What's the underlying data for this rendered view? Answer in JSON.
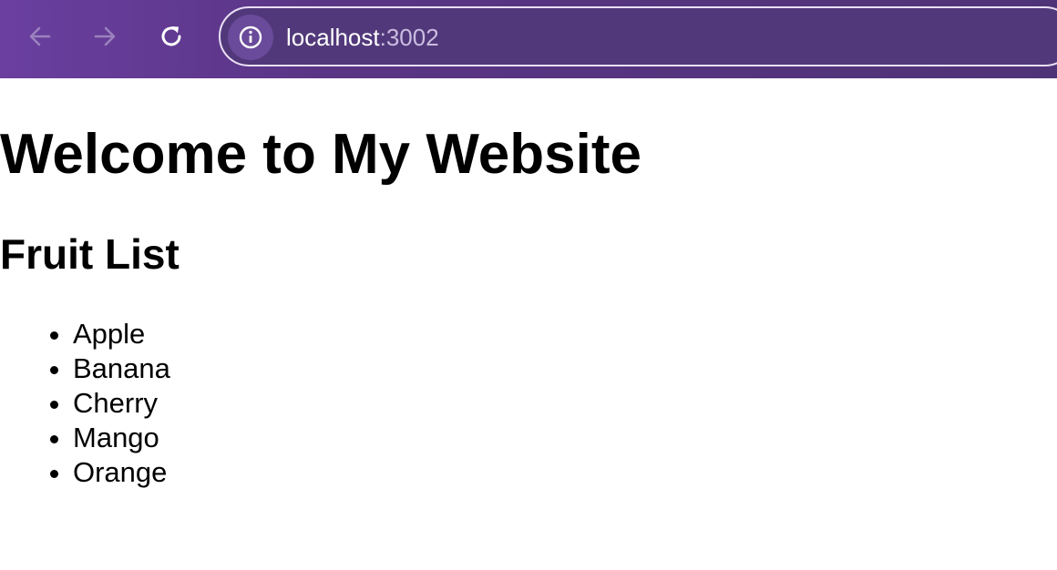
{
  "browser": {
    "url_host": "localhost",
    "url_port": ":3002",
    "back_icon": "arrow-left-icon",
    "forward_icon": "arrow-right-icon",
    "reload_icon": "reload-icon",
    "site_info_icon": "info-icon",
    "toolbar_color": "#5a3585"
  },
  "page": {
    "heading": "Welcome to My Website",
    "subheading": "Fruit List",
    "fruits": [
      "Apple",
      "Banana",
      "Cherry",
      "Mango",
      "Orange"
    ]
  }
}
